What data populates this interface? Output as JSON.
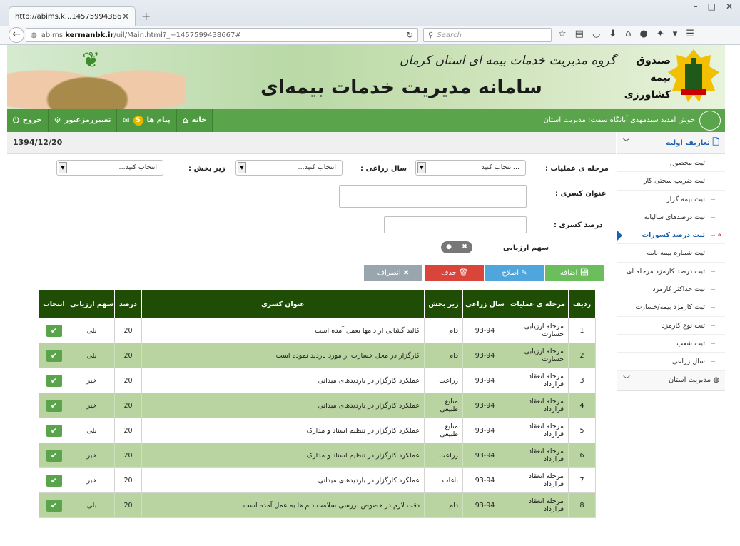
{
  "browser": {
    "tab_title": "http://abims.k...1457599438667#",
    "url_prefix": "abims.",
    "url_domain": "kermanbk.ir",
    "url_path": "/uil/Main.html?_=1457599438667#",
    "search_placeholder": "Search"
  },
  "banner": {
    "subtitle": "گروه مدیریت خدمات بیمه ای استان کرمان",
    "title": "سامانه مدیریت خدمات بیمه‌ای",
    "org_line1": "صندوق",
    "org_line2": "بیمه",
    "org_line3": "کشاورزی"
  },
  "appbar": {
    "welcome": "خوش آمدید   سیدمهدی آبانگاه   سمت:   مدیریت استان",
    "home_label": "خانه",
    "messages_label": "پیام ها",
    "messages_count": "5",
    "change_password_label": "تغییررمزعبور",
    "logout_label": "خروج"
  },
  "date": "1394/12/20",
  "form": {
    "stage_label": "مرحله ی عملیات :",
    "stage_value": "...انتخاب کنید",
    "year_label": "سال زراعی :",
    "year_value": "انتخاب کنید...",
    "subsector_label": "زیر بخش :",
    "subsector_value": "انتخاب کنید...",
    "title_label": "عنوان کسری :",
    "percent_label": "درصد کسری :",
    "share_label": "سهم ارزیابی"
  },
  "actions": {
    "add": "اضافه",
    "edit": "اصلاح",
    "delete": "حذف",
    "cancel": "انصراف"
  },
  "table": {
    "headers": {
      "row": "ردیف",
      "stage": "مرحله ی عملیات",
      "year": "سال زراعی",
      "sub": "زیر بخش",
      "title": "عنوان کسری",
      "percent": "درصد",
      "share": "سهم ارزیابی",
      "select": "انتخاب"
    },
    "rows": [
      {
        "n": "1",
        "stage": "مرحله ارزیابی خسارت",
        "year": "93-94",
        "sub": "دام",
        "title": "کالبد گشایی از دامها بعمل آمده است",
        "pct": "20",
        "share": "بلی"
      },
      {
        "n": "2",
        "stage": "مرحله ارزیابی خسارت",
        "year": "93-94",
        "sub": "دام",
        "title": "کارگزار در محل خسارت از مورد بازدید نموده است",
        "pct": "20",
        "share": "بلی"
      },
      {
        "n": "3",
        "stage": "مرحله انعقاد قرارداد",
        "year": "93-94",
        "sub": "زراعت",
        "title": "عملکرد کارگزار در بازدیدهای میدانی",
        "pct": "20",
        "share": "خیر"
      },
      {
        "n": "4",
        "stage": "مرحله انعقاد قرارداد",
        "year": "93-94",
        "sub": "منابع طبیعی",
        "title": "عملکرد کارگزار در بازدیدهای میدانی",
        "pct": "20",
        "share": "خیر"
      },
      {
        "n": "5",
        "stage": "مرحله انعقاد قرارداد",
        "year": "93-94",
        "sub": "منابع طبیعی",
        "title": "عملکرد کارگزار در تنظیم اسناد و مدارک",
        "pct": "20",
        "share": "بلی"
      },
      {
        "n": "6",
        "stage": "مرحله انعقاد قرارداد",
        "year": "93-94",
        "sub": "زراعت",
        "title": "عملکرد کارگزار در تنظیم اسناد و مدارک",
        "pct": "20",
        "share": "خیر"
      },
      {
        "n": "7",
        "stage": "مرحله انعقاد قرارداد",
        "year": "93-94",
        "sub": "باغات",
        "title": "عملکرد کارگزار در بازدیدهای میدانی",
        "pct": "20",
        "share": "خیر"
      },
      {
        "n": "8",
        "stage": "مرحله انعقاد قرارداد",
        "year": "93-94",
        "sub": "دام",
        "title": "دقت لازم در خصوص بررسی سلامت دام ها به عمل آمده است",
        "pct": "20",
        "share": "بلی"
      }
    ]
  },
  "sidebar": {
    "section1": "تعاریف اولیه",
    "items": [
      "ثبت محصول",
      "ثبت ضریب سختی کار",
      "ثبت بیمه گزار",
      "ثبت درصدهای سالیانه",
      "ثبت درصد کسورات",
      "ثبت شماره بیمه نامه",
      "ثبت درصد کارمزد مرحله ای",
      "ثبت حداکثر کارمزد",
      "ثبت کارمزد بیمه/خسارت",
      "ثبت نوع کارمزد",
      "ثبت شعب",
      "سال زراعی"
    ],
    "section2": "مدیریت استان"
  }
}
